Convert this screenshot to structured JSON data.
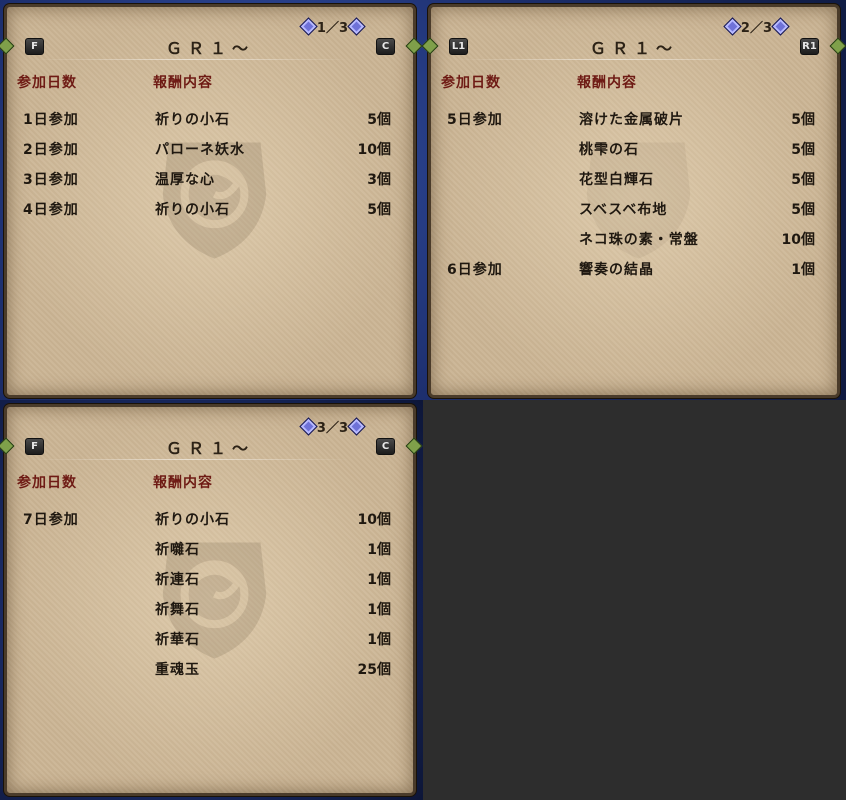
{
  "colors": {
    "header_text": "#6e1a14",
    "body_text": "#1f1810",
    "parchment": "#cbb595",
    "nav_diamond": "#6f72d8"
  },
  "panels": [
    {
      "title": "ＧＲ１～",
      "page": "1／3",
      "left_button": "F",
      "right_button": "C",
      "headers": {
        "day": "参加日数",
        "reward": "報酬内容"
      },
      "rows": [
        {
          "day": "1日参加",
          "item": "祈りの小石",
          "qty": "5個"
        },
        {
          "day": "2日参加",
          "item": "パローネ妖水",
          "qty": "10個"
        },
        {
          "day": "3日参加",
          "item": "温厚な心",
          "qty": "3個"
        },
        {
          "day": "4日参加",
          "item": "祈りの小石",
          "qty": "5個"
        }
      ]
    },
    {
      "title": "ＧＲ１～",
      "page": "2／3",
      "left_button": "L1",
      "right_button": "R1",
      "headers": {
        "day": "参加日数",
        "reward": "報酬内容"
      },
      "rows": [
        {
          "day": "5日参加",
          "item": "溶けた金属破片",
          "qty": "5個"
        },
        {
          "day": "",
          "item": "桃雫の石",
          "qty": "5個"
        },
        {
          "day": "",
          "item": "花型白輝石",
          "qty": "5個"
        },
        {
          "day": "",
          "item": "スベスベ布地",
          "qty": "5個"
        },
        {
          "day": "",
          "item": "ネコ珠の素・常盤",
          "qty": "10個"
        },
        {
          "day": "6日参加",
          "item": "響奏の結晶",
          "qty": "1個"
        }
      ]
    },
    {
      "title": "ＧＲ１～",
      "page": "3／3",
      "left_button": "F",
      "right_button": "C",
      "headers": {
        "day": "参加日数",
        "reward": "報酬内容"
      },
      "rows": [
        {
          "day": "7日参加",
          "item": "祈りの小石",
          "qty": "10個"
        },
        {
          "day": "",
          "item": "祈囃石",
          "qty": "1個"
        },
        {
          "day": "",
          "item": "祈連石",
          "qty": "1個"
        },
        {
          "day": "",
          "item": "祈舞石",
          "qty": "1個"
        },
        {
          "day": "",
          "item": "祈華石",
          "qty": "1個"
        },
        {
          "day": "",
          "item": "重魂玉",
          "qty": "25個"
        }
      ]
    }
  ]
}
